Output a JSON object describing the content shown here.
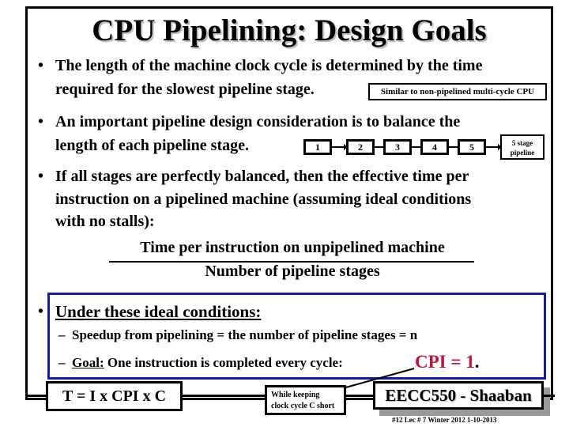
{
  "slide": {
    "title": "CPU Pipelining: Design Goals",
    "bullets": [
      {
        "lines": [
          "The length of the machine clock cycle is determined by the time",
          "required for the slowest pipeline stage."
        ],
        "note": "Similar to non-pipelined multi-cycle CPU"
      },
      {
        "lines": [
          "An important pipeline design consideration is to balance the",
          "length of each pipeline stage."
        ],
        "diagram": {
          "stages": [
            "1",
            "2",
            "3",
            "4",
            "5"
          ],
          "label_line1": "5 stage",
          "label_line2": "pipeline"
        }
      },
      {
        "lines": [
          "If all stages  are perfectly balanced, then the effective time per",
          "instruction on a pipelined machine  (assuming ideal conditions",
          "with no stalls):"
        ]
      }
    ],
    "fraction": {
      "numerator": "Time per instruction on unpipelined machine",
      "denominator": "Number of pipeline stages"
    },
    "ideal": {
      "heading": "Under these ideal conditions:",
      "items": [
        {
          "dash": "–",
          "text": "Speedup from pipelining =  the number of pipeline stages = n"
        },
        {
          "dash": "–",
          "goal_label": "Goal:",
          "text": " One instruction is completed every cycle:"
        }
      ],
      "cpi": "CPI  = 1",
      "cpi_period": ".",
      "cpi_color": "#c0143c"
    },
    "bottom": {
      "formula": "T = I x CPI x C",
      "keeping_line1": "While keeping",
      "keeping_line2": "clock cycle C short",
      "course": "EECC550 - Shaaban"
    },
    "footer": "#12   Lec # 7  Winter 2012  1-10-2013",
    "bullet_glyph": "•"
  }
}
